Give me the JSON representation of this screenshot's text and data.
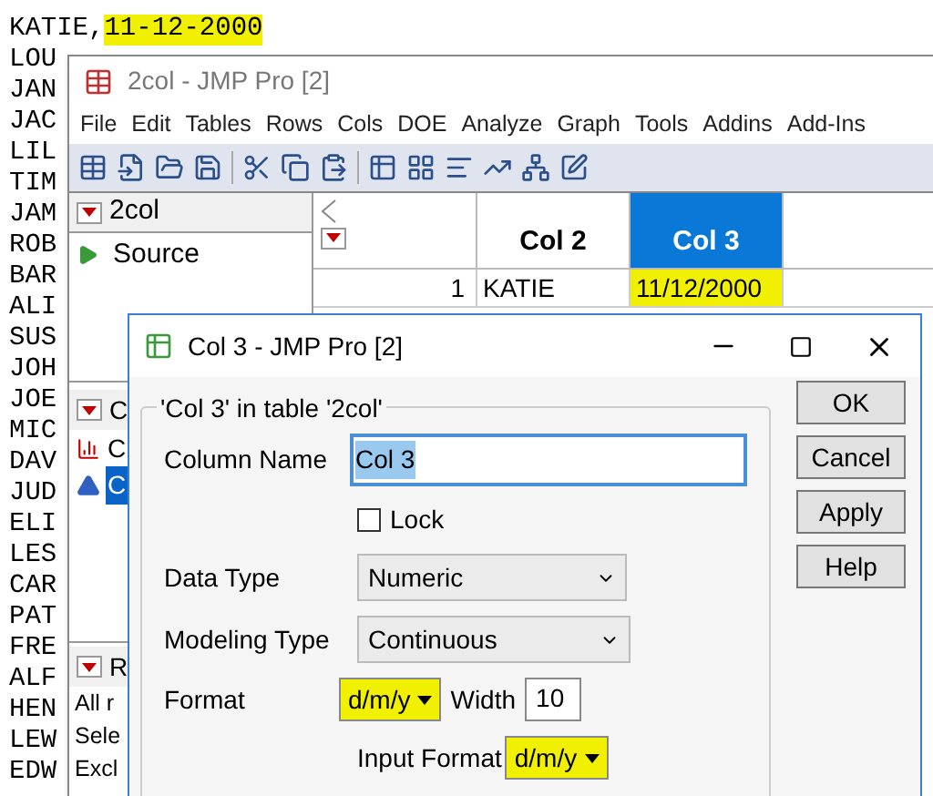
{
  "text_file": {
    "first_line": {
      "name": "KATIE,",
      "date": "11-12-2000",
      "highlighted": true
    },
    "lines": [
      "LOU",
      "JAN",
      "JAC",
      "LIL",
      "TIM",
      "JAM",
      "ROB",
      "BAR",
      "ALI",
      "SUS",
      "JOH",
      "JOE",
      "MIC",
      "DAV",
      "JUD",
      "ELI",
      "LES",
      "CAR",
      "PAT",
      "FRE",
      "ALF",
      "HEN",
      "LEW",
      "EDW"
    ]
  },
  "jmp_window": {
    "title": "2col - JMP Pro [2]",
    "menu": [
      "File",
      "Edit",
      "Tables",
      "Rows",
      "Cols",
      "DOE",
      "Analyze",
      "Graph",
      "Tools",
      "Addins",
      "Add-Ins"
    ],
    "table_panel": {
      "title": "2col",
      "items": [
        "Source"
      ]
    },
    "columns_panel": {
      "title": "C",
      "columns": [
        {
          "label": "C",
          "kind": "nominal",
          "selected": false
        },
        {
          "label": "C",
          "kind": "continuous",
          "selected": true
        }
      ]
    },
    "rows_panel": {
      "title": "R",
      "items": [
        "All r",
        "Sele",
        "Excl"
      ]
    },
    "grid": {
      "columns": [
        {
          "label": "Col 2",
          "selected": false
        },
        {
          "label": "Col 3",
          "selected": true
        }
      ],
      "rows": [
        {
          "number": "1",
          "cells": [
            {
              "text": "KATIE",
              "highlighted": false
            },
            {
              "text": "11/12/2000",
              "highlighted": true
            }
          ]
        }
      ]
    }
  },
  "dialog": {
    "title": "Col 3 - JMP Pro [2]",
    "group_title": "'Col 3' in table '2col'",
    "column_name": {
      "label": "Column Name",
      "value": "Col 3",
      "selected": true
    },
    "lock": {
      "label": "Lock",
      "checked": false
    },
    "data_type": {
      "label": "Data Type",
      "value": "Numeric"
    },
    "modeling_type": {
      "label": "Modeling Type",
      "value": "Continuous"
    },
    "format": {
      "label": "Format",
      "value": "d/m/y",
      "highlighted": true
    },
    "width": {
      "label": "Width",
      "value": "10"
    },
    "input_format": {
      "label": "Input Format",
      "value": "d/m/y",
      "highlighted": true
    },
    "buttons": [
      "OK",
      "Cancel",
      "Apply",
      "Help"
    ]
  }
}
